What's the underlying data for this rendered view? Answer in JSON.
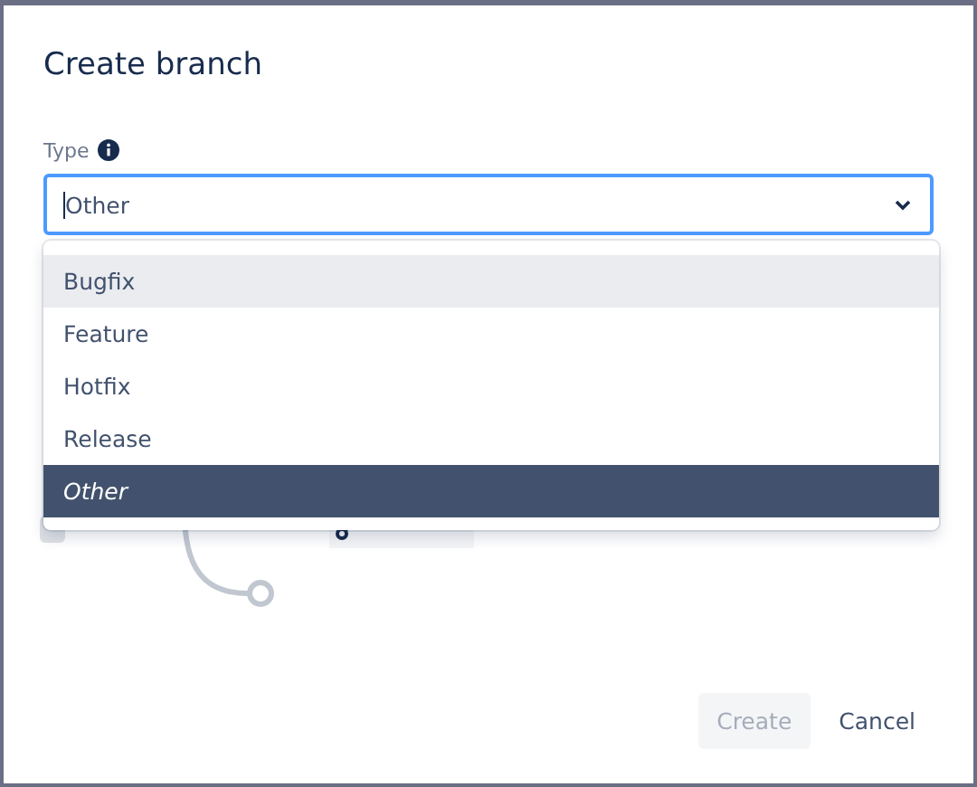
{
  "dialog": {
    "title": "Create branch"
  },
  "type_field": {
    "label": "Type",
    "value": "Other",
    "open": true
  },
  "options": [
    {
      "label": "Bugfix",
      "selected": false,
      "hovered": true
    },
    {
      "label": "Feature",
      "selected": false,
      "hovered": false
    },
    {
      "label": "Hotfix",
      "selected": false,
      "hovered": false
    },
    {
      "label": "Release",
      "selected": false,
      "hovered": false
    },
    {
      "label": "Other",
      "selected": true,
      "hovered": false
    }
  ],
  "buttons": [
    {
      "label": "Create",
      "kind": "primary",
      "disabled": true
    },
    {
      "label": "Cancel",
      "kind": "subtle",
      "disabled": false
    }
  ]
}
